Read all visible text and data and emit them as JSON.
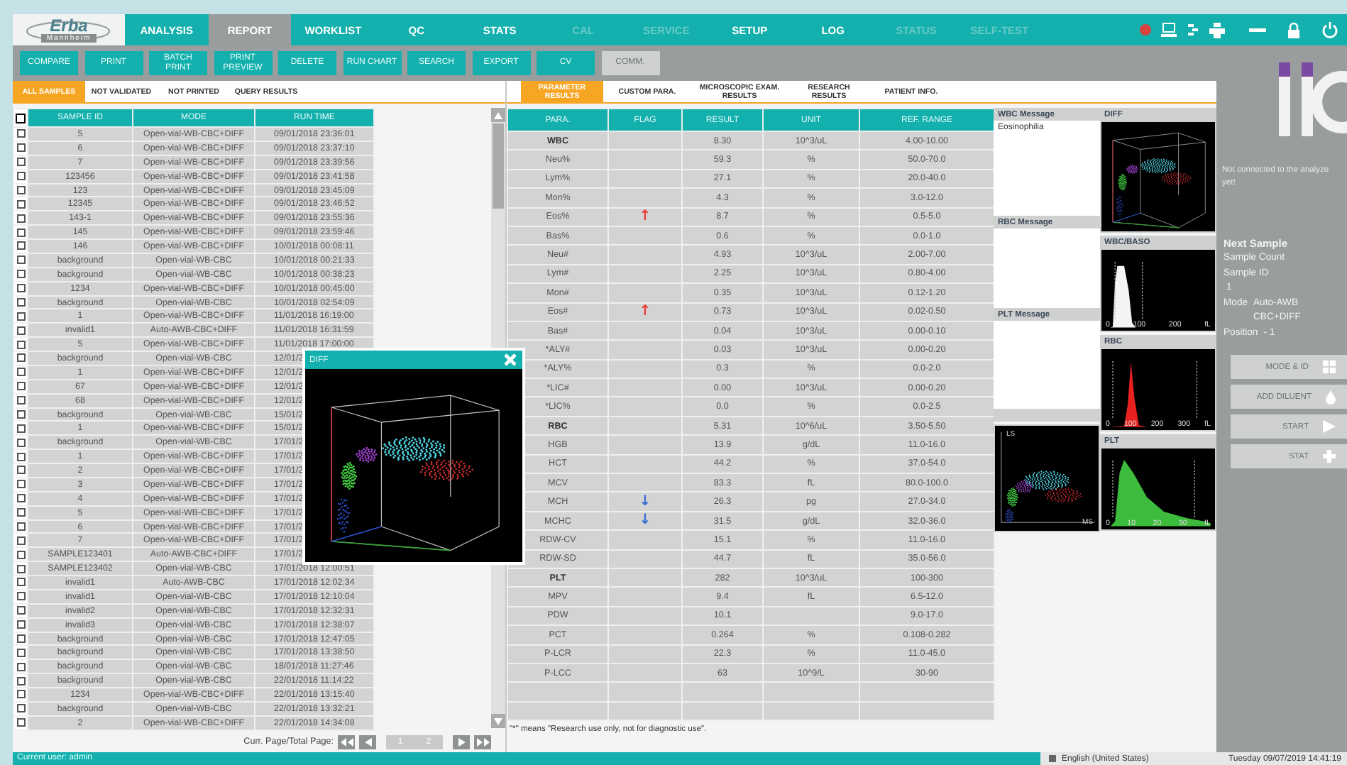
{
  "logo": {
    "brand": "Erba",
    "sub": "Mannheim"
  },
  "nav_tabs": [
    {
      "label": "ANALYSIS",
      "selected": false,
      "disabled": false
    },
    {
      "label": "REPORT",
      "selected": true,
      "disabled": false
    },
    {
      "label": "WORKLIST",
      "selected": false,
      "disabled": false
    },
    {
      "label": "QC",
      "selected": false,
      "disabled": false
    },
    {
      "label": "STATS",
      "selected": false,
      "disabled": false
    },
    {
      "label": "CAL",
      "selected": false,
      "disabled": true
    },
    {
      "label": "SERVICE",
      "selected": false,
      "disabled": true
    },
    {
      "label": "SETUP",
      "selected": false,
      "disabled": false
    },
    {
      "label": "LOG",
      "selected": false,
      "disabled": false
    },
    {
      "label": "STATUS",
      "selected": false,
      "disabled": true
    },
    {
      "label": "SELF-TEST",
      "selected": false,
      "disabled": true
    }
  ],
  "toolbar": [
    {
      "label": "COMPARE",
      "disabled": false
    },
    {
      "label": "PRINT",
      "disabled": false
    },
    {
      "label": "BATCH PRINT",
      "disabled": false
    },
    {
      "label": "PRINT PREVIEW",
      "disabled": false
    },
    {
      "label": "DELETE",
      "disabled": false
    },
    {
      "label": "RUN CHART",
      "disabled": false
    },
    {
      "label": "SEARCH",
      "disabled": false
    },
    {
      "label": "EXPORT",
      "disabled": false
    },
    {
      "label": "CV",
      "disabled": false
    },
    {
      "label": "COMM.",
      "disabled": true
    }
  ],
  "sample_filters": [
    {
      "label": "ALL SAMPLES",
      "selected": true
    },
    {
      "label": "NOT VALIDATED",
      "selected": false
    },
    {
      "label": "NOT PRINTED",
      "selected": false
    },
    {
      "label": "QUERY RESULTS",
      "selected": false
    }
  ],
  "sample_table": {
    "columns": [
      "SAMPLE ID",
      "MODE",
      "RUN TIME"
    ],
    "all_checked": false,
    "rows": [
      {
        "id": "5",
        "mode": "Open-vial-WB-CBC+DIFF",
        "run_time": "09/01/2018 23:36:01",
        "checked": false
      },
      {
        "id": "6",
        "mode": "Open-vial-WB-CBC+DIFF",
        "run_time": "09/01/2018 23:37:10",
        "checked": false
      },
      {
        "id": "7",
        "mode": "Open-vial-WB-CBC+DIFF",
        "run_time": "09/01/2018 23:39:56",
        "checked": false
      },
      {
        "id": "123456",
        "mode": "Open-vial-WB-CBC+DIFF",
        "run_time": "09/01/2018 23:41:58",
        "checked": false
      },
      {
        "id": "123",
        "mode": "Open-vial-WB-CBC+DIFF",
        "run_time": "09/01/2018 23:45:09",
        "checked": false
      },
      {
        "id": "12345",
        "mode": "Open-vial-WB-CBC+DIFF",
        "run_time": "09/01/2018 23:46:52",
        "checked": false
      },
      {
        "id": "143-1",
        "mode": "Open-vial-WB-CBC+DIFF",
        "run_time": "09/01/2018 23:55:36",
        "checked": false
      },
      {
        "id": "145",
        "mode": "Open-vial-WB-CBC+DIFF",
        "run_time": "09/01/2018 23:59:46",
        "checked": false
      },
      {
        "id": "146",
        "mode": "Open-vial-WB-CBC+DIFF",
        "run_time": "10/01/2018 00:08:11",
        "checked": false
      },
      {
        "id": "background",
        "mode": "Open-vial-WB-CBC",
        "run_time": "10/01/2018 00:21:33",
        "checked": false
      },
      {
        "id": "background",
        "mode": "Open-vial-WB-CBC",
        "run_time": "10/01/2018 00:38:23",
        "checked": false
      },
      {
        "id": "1234",
        "mode": "Open-vial-WB-CBC+DIFF",
        "run_time": "10/01/2018 00:45:00",
        "checked": false
      },
      {
        "id": "background",
        "mode": "Open-vial-WB-CBC",
        "run_time": "10/01/2018 02:54:09",
        "checked": false
      },
      {
        "id": "1",
        "mode": "Open-vial-WB-CBC+DIFF",
        "run_time": "11/01/2018 16:19:00",
        "checked": false
      },
      {
        "id": "invalid1",
        "mode": "Auto-AWB-CBC+DIFF",
        "run_time": "11/01/2018 16:31:59",
        "checked": false
      },
      {
        "id": "5",
        "mode": "Open-vial-WB-CBC+DIFF",
        "run_time": "11/01/2018 17:00:00",
        "checked": false
      },
      {
        "id": "background",
        "mode": "Open-vial-WB-CBC",
        "run_time": "12/01/2",
        "checked": false
      },
      {
        "id": "1",
        "mode": "Open-vial-WB-CBC+DIFF",
        "run_time": "12/01/2",
        "checked": false
      },
      {
        "id": "67",
        "mode": "Open-vial-WB-CBC+DIFF",
        "run_time": "12/01/2",
        "checked": false
      },
      {
        "id": "68",
        "mode": "Open-vial-WB-CBC+DIFF",
        "run_time": "12/01/2",
        "checked": false
      },
      {
        "id": "background",
        "mode": "Open-vial-WB-CBC",
        "run_time": "15/01/2",
        "checked": false
      },
      {
        "id": "1",
        "mode": "Open-vial-WB-CBC+DIFF",
        "run_time": "15/01/2",
        "checked": false
      },
      {
        "id": "background",
        "mode": "Open-vial-WB-CBC",
        "run_time": "17/01/2",
        "checked": false
      },
      {
        "id": "1",
        "mode": "Open-vial-WB-CBC+DIFF",
        "run_time": "17/01/2",
        "checked": false
      },
      {
        "id": "2",
        "mode": "Open-vial-WB-CBC+DIFF",
        "run_time": "17/01/2",
        "checked": false
      },
      {
        "id": "3",
        "mode": "Open-vial-WB-CBC+DIFF",
        "run_time": "17/01/2",
        "checked": false
      },
      {
        "id": "4",
        "mode": "Open-vial-WB-CBC+DIFF",
        "run_time": "17/01/2",
        "checked": false
      },
      {
        "id": "5",
        "mode": "Open-vial-WB-CBC+DIFF",
        "run_time": "17/01/2",
        "checked": false
      },
      {
        "id": "6",
        "mode": "Open-vial-WB-CBC+DIFF",
        "run_time": "17/01/2",
        "checked": false
      },
      {
        "id": "7",
        "mode": "Open-vial-WB-CBC+DIFF",
        "run_time": "17/01/2",
        "checked": false
      },
      {
        "id": "SAMPLE123401",
        "mode": "Auto-AWB-CBC+DIFF",
        "run_time": "17/01/2",
        "checked": false
      },
      {
        "id": "SAMPLE123402",
        "mode": "Open-vial-WB-CBC",
        "run_time": "17/01/2018 12:00:51",
        "checked": false
      },
      {
        "id": "invalid1",
        "mode": "Auto-AWB-CBC",
        "run_time": "17/01/2018 12:02:34",
        "checked": false
      },
      {
        "id": "invalid1",
        "mode": "Open-vial-WB-CBC",
        "run_time": "17/01/2018 12:10:04",
        "checked": false
      },
      {
        "id": "invalid2",
        "mode": "Open-vial-WB-CBC",
        "run_time": "17/01/2018 12:32:31",
        "checked": false
      },
      {
        "id": "invalid3",
        "mode": "Open-vial-WB-CBC",
        "run_time": "17/01/2018 12:38:07",
        "checked": false
      },
      {
        "id": "background",
        "mode": "Open-vial-WB-CBC",
        "run_time": "17/01/2018 12:47:05",
        "checked": false
      },
      {
        "id": "background",
        "mode": "Open-vial-WB-CBC",
        "run_time": "17/01/2018 13:38:50",
        "checked": false
      },
      {
        "id": "background",
        "mode": "Open-vial-WB-CBC",
        "run_time": "18/01/2018 11:27:46",
        "checked": false
      },
      {
        "id": "background",
        "mode": "Open-vial-WB-CBC",
        "run_time": "22/01/2018 11:14:22",
        "checked": false
      },
      {
        "id": "1234",
        "mode": "Open-vial-WB-CBC+DIFF",
        "run_time": "22/01/2018 13:15:40",
        "checked": false
      },
      {
        "id": "background",
        "mode": "Open-vial-WB-CBC",
        "run_time": "22/01/2018 13:32:21",
        "checked": false
      },
      {
        "id": "2",
        "mode": "Open-vial-WB-CBC+DIFF",
        "run_time": "22/01/2018 14:34:08",
        "checked": false
      }
    ]
  },
  "pager": {
    "label": "Curr. Page/Total Page:",
    "current": "1",
    "total": "2"
  },
  "result_tabs": [
    {
      "label": "PARAMETER RESULTS",
      "selected": true
    },
    {
      "label": "CUSTOM PARA.",
      "selected": false
    },
    {
      "label": "MICROSCOPIC EXAM. RESULTS",
      "selected": false
    },
    {
      "label": "RESEARCH RESULTS",
      "selected": false
    },
    {
      "label": "PATIENT INFO.",
      "selected": false
    }
  ],
  "results_table": {
    "columns": [
      "PARA.",
      "FLAG",
      "RESULT",
      "UNIT",
      "REF. RANGE"
    ],
    "rows": [
      {
        "kind": "group",
        "para": "WBC",
        "result": "8.30",
        "unit": "10^3/uL",
        "range": "4.00-10.00"
      },
      {
        "kind": "param",
        "para": "Neu%",
        "result": "59.3",
        "unit": "%",
        "range": "50.0-70.0"
      },
      {
        "kind": "param",
        "para": "Lym%",
        "result": "27.1",
        "unit": "%",
        "range": "20.0-40.0"
      },
      {
        "kind": "param",
        "para": "Mon%",
        "result": "4.3",
        "unit": "%",
        "range": "3.0-12.0"
      },
      {
        "kind": "param",
        "para": "Eos%",
        "flag": {
          "text": "↑",
          "color": "#e8403a"
        },
        "result": "8.7",
        "unit": "%",
        "range": "0.5-5.0"
      },
      {
        "kind": "param",
        "para": "Bas%",
        "result": "0.6",
        "unit": "%",
        "range": "0.0-1.0"
      },
      {
        "kind": "param",
        "para": "Neu#",
        "result": "4.93",
        "unit": "10^3/uL",
        "range": "2.00-7.00"
      },
      {
        "kind": "param",
        "para": "Lym#",
        "result": "2.25",
        "unit": "10^3/uL",
        "range": "0.80-4.00"
      },
      {
        "kind": "param",
        "para": "Mon#",
        "result": "0.35",
        "unit": "10^3/uL",
        "range": "0.12-1.20"
      },
      {
        "kind": "param",
        "para": "Eos#",
        "flag": {
          "text": "↑",
          "color": "#e8403a"
        },
        "result": "0.73",
        "unit": "10^3/uL",
        "range": "0.02-0.50"
      },
      {
        "kind": "param",
        "para": "Bas#",
        "result": "0.04",
        "unit": "10^3/uL",
        "range": "0.00-0.10"
      },
      {
        "kind": "param",
        "para": "*ALY#",
        "result": "0.03",
        "unit": "10^3/uL",
        "range": "0.00-0.20"
      },
      {
        "kind": "param",
        "para": "*ALY%",
        "result": "0.3",
        "unit": "%",
        "range": "0.0-2.0"
      },
      {
        "kind": "param",
        "para": "*LIC#",
        "result": "0.00",
        "unit": "10^3/uL",
        "range": "0.00-0.20"
      },
      {
        "kind": "param",
        "para": "*LIC%",
        "result": "0.0",
        "unit": "%",
        "range": "0.0-2.5"
      },
      {
        "kind": "group",
        "para": "RBC",
        "result": "5.31",
        "unit": "10^6/uL",
        "range": "3.50-5.50"
      },
      {
        "kind": "param",
        "para": "HGB",
        "result": "13.9",
        "unit": "g/dL",
        "range": "11.0-16.0"
      },
      {
        "kind": "param",
        "para": "HCT",
        "result": "44.2",
        "unit": "%",
        "range": "37.0-54.0"
      },
      {
        "kind": "param",
        "para": "MCV",
        "result": "83.3",
        "unit": "fL",
        "range": "80.0-100.0"
      },
      {
        "kind": "param",
        "para": "MCH",
        "flag": {
          "text": "↓",
          "color": "#3a6fd8"
        },
        "result": "26.3",
        "unit": "pg",
        "range": "27.0-34.0"
      },
      {
        "kind": "param",
        "para": "MCHC",
        "flag": {
          "text": "↓",
          "color": "#3a6fd8"
        },
        "result": "31.5",
        "unit": "g/dL",
        "range": "32.0-36.0"
      },
      {
        "kind": "param",
        "para": "RDW-CV",
        "result": "15.1",
        "unit": "%",
        "range": "11.0-16.0"
      },
      {
        "kind": "param",
        "para": "RDW-SD",
        "result": "44.7",
        "unit": "fL",
        "range": "35.0-56.0"
      },
      {
        "kind": "group",
        "para": "PLT",
        "result": "282",
        "unit": "10^3/uL",
        "range": "100-300"
      },
      {
        "kind": "param",
        "para": "MPV",
        "result": "9.4",
        "unit": "fL",
        "range": "6.5-12.0"
      },
      {
        "kind": "param",
        "para": "PDW",
        "result": "10.1",
        "range": "9.0-17.0"
      },
      {
        "kind": "param",
        "para": "PCT",
        "result": "0.264",
        "unit": "%",
        "range": "0.108-0.282"
      },
      {
        "kind": "param",
        "para": "P-LCR",
        "result": "22.3",
        "unit": "%",
        "range": "11.0-45.0"
      },
      {
        "kind": "param",
        "para": "P-LCC",
        "result": "63",
        "unit": "10^9/L",
        "range": "30-90"
      },
      {
        "kind": "blank"
      },
      {
        "kind": "blank"
      }
    ]
  },
  "footnote": "\"*\" means \"Research use only, not for diagnostic use\".",
  "messages": [
    {
      "title": "WBC Message",
      "text": "Eosinophilia"
    },
    {
      "title": "RBC Message"
    },
    {
      "title": "PLT Message"
    }
  ],
  "scatter_panel": {
    "y_label": "LS",
    "x_label": "MS"
  },
  "graphs": [
    {
      "title": "DIFF",
      "kind": "scatter3d"
    },
    {
      "title": "WBC/BASO",
      "kind": "histogram",
      "color": "#f4f4f4",
      "ticks": [
        "0",
        "100",
        "200",
        "fL"
      ]
    },
    {
      "title": "RBC",
      "kind": "histogram",
      "color": "#e82020",
      "ticks": [
        "0",
        "100",
        "200",
        "300",
        "fL"
      ]
    },
    {
      "title": "PLT",
      "kind": "histogram",
      "color": "#3dbb3d",
      "ticks": [
        "0",
        "10",
        "20",
        "30",
        "fL"
      ]
    }
  ],
  "popup": {
    "title": "DIFF"
  },
  "sidebar": {
    "status_lines": [
      "Not connected to the analyze",
      "yet!"
    ],
    "next_sample": {
      "title": "Next Sample",
      "fields": [
        {
          "label": "Sample Count"
        },
        {
          "label": "Sample ID"
        },
        {
          "value": "1"
        },
        {
          "label": "Mode",
          "value": "Auto-AWB CBC+DIFF"
        },
        {
          "label": "Position",
          "value": "- 1"
        }
      ]
    },
    "buttons": [
      {
        "label": "MODE & ID",
        "disabled": true
      },
      {
        "label": "ADD DILUENT",
        "disabled": true
      },
      {
        "label": "START",
        "disabled": true
      },
      {
        "label": "STAT",
        "disabled": true
      }
    ]
  },
  "status_bar": {
    "user": "Current user: admin",
    "language": "English (United States)",
    "datetime": "Tuesday 09/07/2019 14:41:19"
  }
}
